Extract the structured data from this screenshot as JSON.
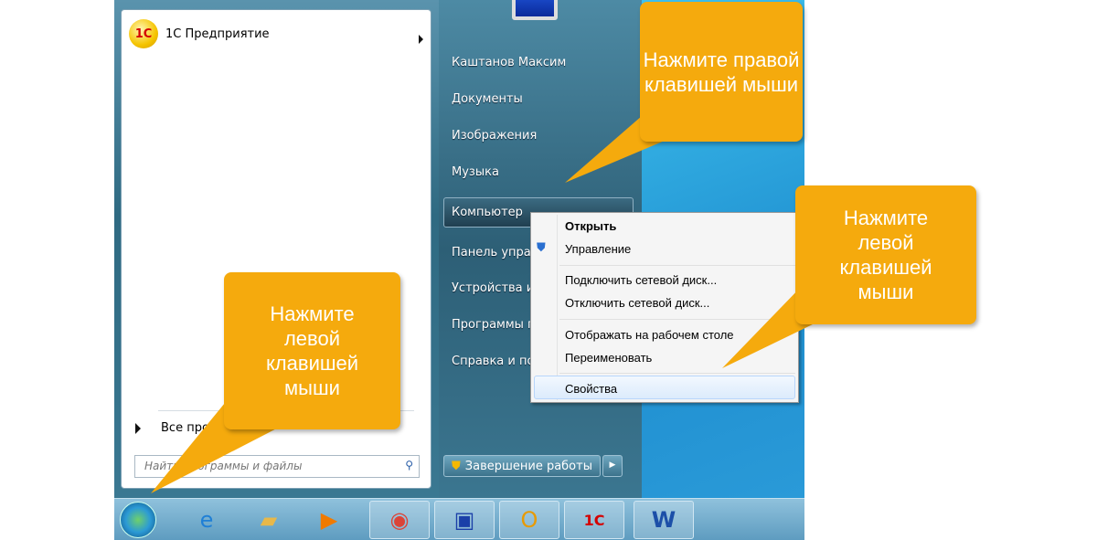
{
  "start_menu": {
    "pinned": [
      {
        "label": "1С Предприятие",
        "icon": "1c-icon"
      }
    ],
    "all_programs": "Все программы",
    "search_placeholder": "Найти программы и файлы",
    "right_items": [
      "Каштанов Максим",
      "Документы",
      "Изображения",
      "Музыка",
      "Компьютер",
      "Панель управления",
      "Устройства и принтеры",
      "Программы по умолчанию",
      "Справка и поддержка"
    ],
    "shutdown": "Завершение работы"
  },
  "context_menu": {
    "items": [
      "Открыть",
      "Управление",
      "Подключить сетевой диск...",
      "Отключить сетевой диск...",
      "Отображать на рабочем столе",
      "Переименовать",
      "Свойства"
    ]
  },
  "callouts": [
    "Нажмите правой клавишей мыши",
    "Нажмите левой клавишей мыши",
    "Нажмите левой клавишей мыши"
  ],
  "taskbar": {
    "icons": [
      "start-orb",
      "internet-explorer",
      "file-explorer",
      "media-player",
      "chrome",
      "remote-desktop",
      "outlook",
      "1c",
      "word"
    ]
  },
  "colors": {
    "callout": "#f5aa0d",
    "accent": "#2f6a82"
  }
}
